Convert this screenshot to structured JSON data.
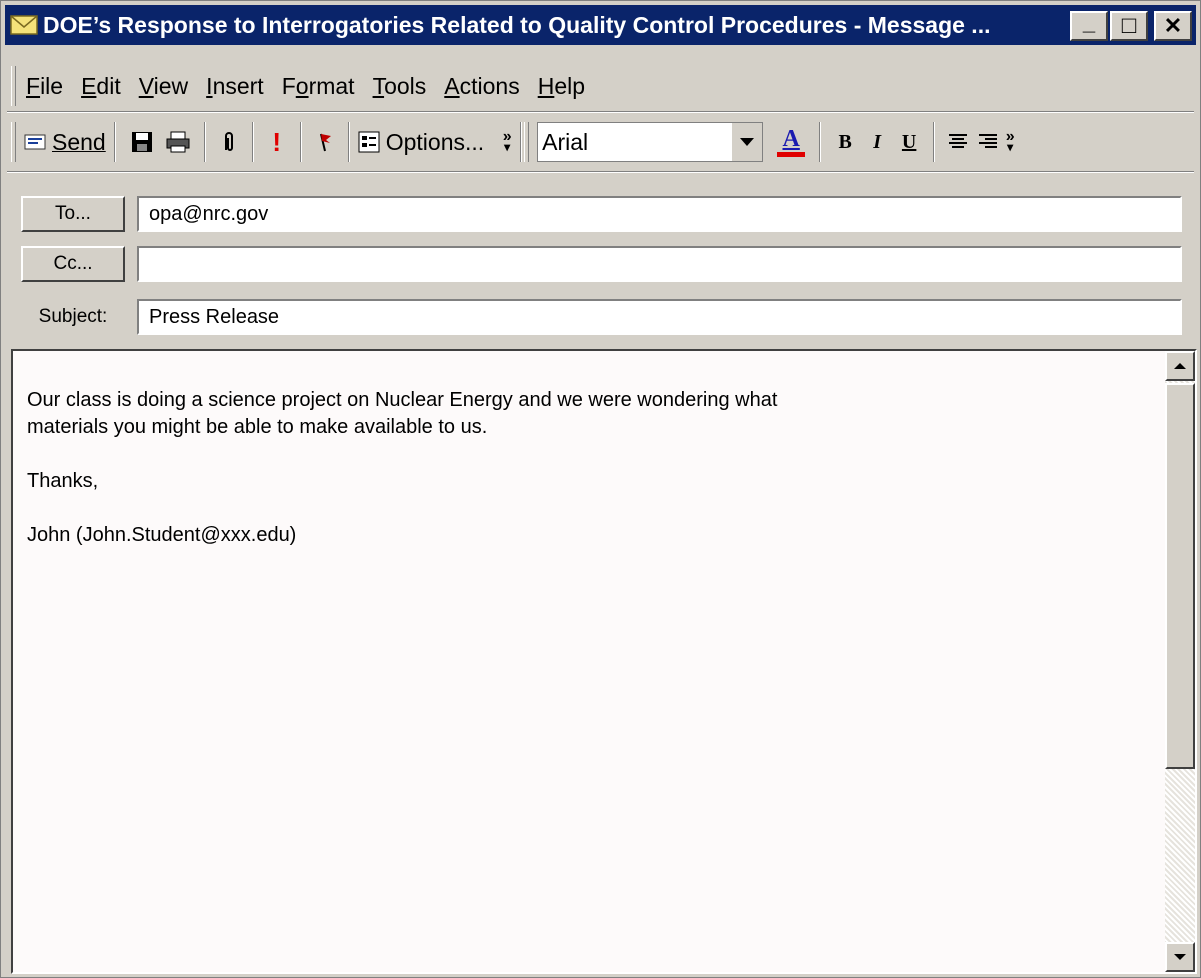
{
  "window": {
    "title": "DOE’s Response to Interrogatories Related to Quality Control Procedures - Message ...",
    "minimize_glyph": "_",
    "maximize_glyph": "□",
    "close_glyph": "✕"
  },
  "menu": {
    "items": [
      {
        "u": "F",
        "rest": "ile"
      },
      {
        "u": "E",
        "rest": "dit"
      },
      {
        "u": "V",
        "rest": "iew"
      },
      {
        "u": "I",
        "rest": "nsert"
      },
      {
        "pre": "F",
        "u": "o",
        "rest": "rmat"
      },
      {
        "u": "T",
        "rest": "ools"
      },
      {
        "u": "A",
        "rest": "ctions"
      },
      {
        "u": "H",
        "rest": "elp"
      }
    ]
  },
  "toolbar": {
    "send_label": "Send",
    "options_label": "Options...",
    "font_name": "Arial",
    "bold_label": "B",
    "italic_label": "I",
    "underline_label": "U",
    "font_color_label": "A",
    "importance_label": "!",
    "accent_color": "#cc0000"
  },
  "fields": {
    "to_button": "To...",
    "to_value": "opa@nrc.gov",
    "cc_button": "Cc...",
    "cc_value": "",
    "subject_label": "Subject:",
    "subject_value": "Press Release"
  },
  "body": {
    "text": "Our class is doing a science project on Nuclear Energy and we were wondering what\nmaterials you might be able to make available to us.\n\nThanks,\n\nJohn (John.Student@xxx.edu)"
  },
  "colors": {
    "titlebar": "#0a246a",
    "chrome": "#d4d0c8"
  }
}
